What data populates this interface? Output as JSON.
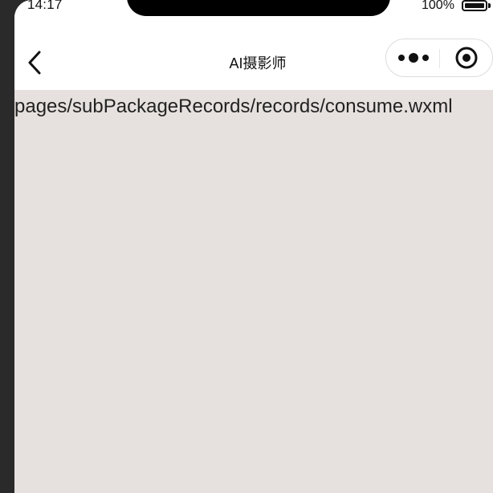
{
  "status_bar": {
    "time": "14:17",
    "battery_percent": "100%",
    "battery_level": 1.0
  },
  "nav": {
    "title": "AI摄影师",
    "back_icon": "chevron-left-icon",
    "more_icon": "more-dots-icon",
    "close_icon": "target-close-icon"
  },
  "content": {
    "page_path": "pages/subPackageRecords/records/consume.wxml",
    "background_color": "#e6e1de"
  }
}
